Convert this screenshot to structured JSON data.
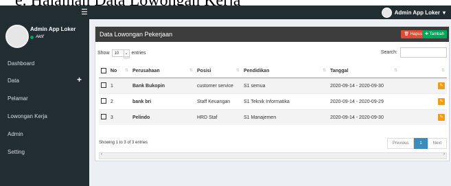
{
  "doc_caption": "e. Halaman Data Lowongan Kerja",
  "topbar": {
    "menu_icon": "☰",
    "user_name": "Admin App Loker",
    "caret": "▾"
  },
  "sidebar": {
    "user_name": "Admin App Loker",
    "status": "Aktif",
    "items": [
      {
        "label": "Dashboard"
      },
      {
        "label": "Data",
        "expander": "+"
      },
      {
        "label": "Pelamar"
      },
      {
        "label": "Lowongan Kerja"
      },
      {
        "label": "Admin"
      },
      {
        "label": "Setting"
      }
    ]
  },
  "panel": {
    "title": "Data Lowongan Pekerjaan",
    "hapus_label": "Hapus",
    "tambah_label": "Tambah",
    "show_label": "Show",
    "show_value": "10",
    "entries_label": "entries",
    "search_label": "Search:",
    "search_value": ""
  },
  "table": {
    "headers": [
      "No",
      "Perusahaan",
      "Posisi",
      "Pendidikan",
      "Tanggal"
    ],
    "rows": [
      {
        "no": "1",
        "perusahaan": "Bank Bukopin",
        "posisi": "customer service",
        "pendidikan": "S1 semua",
        "tanggal": "2020-09-14 - 2020-09-30"
      },
      {
        "no": "2",
        "perusahaan": "bank bri",
        "posisi": "Staff Keuangan",
        "pendidikan": "S1 Teknik Informatika",
        "tanggal": "2020-09-14 - 2020-09-29"
      },
      {
        "no": "3",
        "perusahaan": "Pelindo",
        "posisi": "HRD Staf",
        "pendidikan": "S1 Manajemen",
        "tanggal": "2020-09-14 - 2020-09-30"
      }
    ]
  },
  "footer": {
    "info": "Showing 1 to 3 of 3 entries",
    "previous_label": "Previous",
    "page": "1",
    "next_label": "Next"
  },
  "colors": {
    "sidebar_bg": "#222d32",
    "panel_header": "#3c3c3c",
    "hapus": "#dd4b39",
    "tambah": "#00a65a",
    "edit": "#f39c12",
    "page_active": "#3c8dbc"
  }
}
